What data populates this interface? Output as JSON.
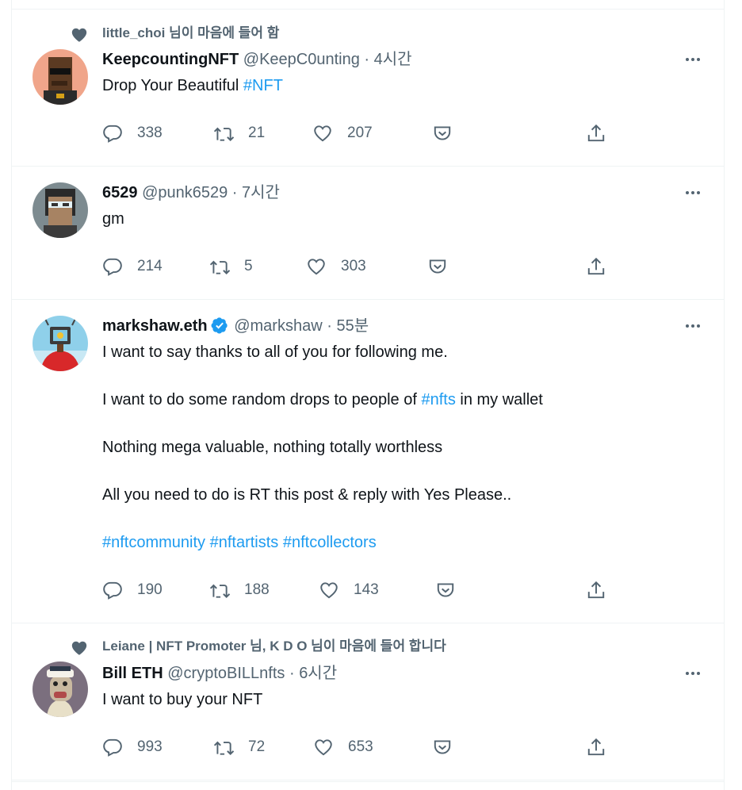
{
  "tweets": [
    {
      "social_context": "little_choi 님이 마음에 들어 함",
      "name": "KeepcountingNFT",
      "handle": "@KeepC0unting",
      "sep": "·",
      "time": "4시간",
      "body": [
        {
          "text": "Drop Your Beautiful ",
          "tag": "#NFT"
        }
      ],
      "replies": "338",
      "retweets": "21",
      "likes": "207",
      "avatar_bg": "#f0a58a"
    },
    {
      "name": "6529",
      "handle": "@punk6529",
      "sep": "·",
      "time": "7시간",
      "body": [
        {
          "text": "gm",
          "tag": ""
        }
      ],
      "replies": "214",
      "retweets": "5",
      "likes": "303",
      "avatar_bg": "#7d8b90"
    },
    {
      "name": "markshaw.eth",
      "verified": true,
      "handle": "@markshaw",
      "sep": "·",
      "time": "55분",
      "paragraphs": [
        {
          "pre": "I want to say thanks to all of you for following me.",
          "tag": "",
          "post": ""
        },
        {
          "pre": "I want to do some random drops to people of ",
          "tag": "#nfts",
          "post": " in my wallet"
        },
        {
          "pre": "Nothing mega valuable, nothing totally worthless",
          "tag": "",
          "post": ""
        },
        {
          "pre": "All you need to do is RT this post & reply with Yes Please..",
          "tag": "",
          "post": ""
        },
        {
          "pre": "",
          "tag": "#nftcommunity #nftartists #nftcollectors",
          "post": ""
        }
      ],
      "replies": "190",
      "retweets": "188",
      "likes": "143",
      "avatar_bg": "#8fd0ea"
    },
    {
      "social_context": "Leiane | NFT Promoter 님, K D O 님이 마음에 들어 합니다",
      "name": "Bill ETH",
      "handle": "@cryptoBILLnfts",
      "sep": "·",
      "time": "6시간",
      "body": [
        {
          "text": "I want to buy your NFT",
          "tag": ""
        }
      ],
      "replies": "993",
      "retweets": "72",
      "likes": "653",
      "avatar_bg": "#7b6f7e"
    }
  ],
  "icons": {
    "like_context": "heart-filled-icon",
    "reply": "speech-bubble-icon",
    "retweet": "retweet-arrows-icon",
    "like": "heart-outline-icon",
    "save": "pocket-save-icon",
    "share": "share-upload-icon",
    "more": "more-dots-icon",
    "verified": "verified-badge-icon"
  },
  "colors": {
    "link": "#1d9bf0",
    "muted": "#536471",
    "text": "#0f1419",
    "verified": "#1d9bf0"
  }
}
